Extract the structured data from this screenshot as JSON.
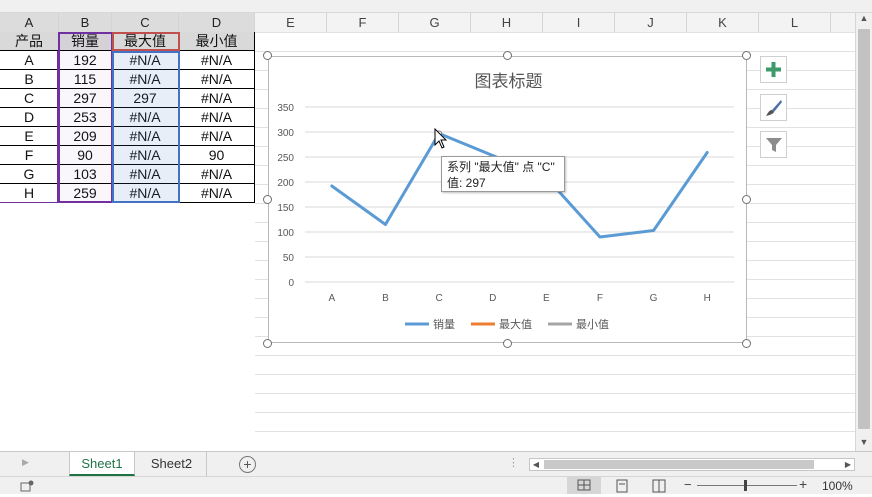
{
  "columns": [
    "A",
    "B",
    "C",
    "D",
    "E",
    "F",
    "G",
    "H",
    "I",
    "J",
    "K",
    "L"
  ],
  "table": {
    "headers": [
      "产品",
      "销量",
      "最大值",
      "最小值"
    ],
    "rows": [
      [
        "A",
        "192",
        "#N/A",
        "#N/A"
      ],
      [
        "B",
        "115",
        "#N/A",
        "#N/A"
      ],
      [
        "C",
        "297",
        "297",
        "#N/A"
      ],
      [
        "D",
        "253",
        "#N/A",
        "#N/A"
      ],
      [
        "E",
        "209",
        "#N/A",
        "#N/A"
      ],
      [
        "F",
        "90",
        "#N/A",
        "90"
      ],
      [
        "G",
        "103",
        "#N/A",
        "#N/A"
      ],
      [
        "H",
        "259",
        "#N/A",
        "#N/A"
      ]
    ]
  },
  "chart_data": {
    "type": "line",
    "title": "图表标题",
    "categories": [
      "A",
      "B",
      "C",
      "D",
      "E",
      "F",
      "G",
      "H"
    ],
    "series": [
      {
        "name": "销量",
        "values": [
          192,
          115,
          297,
          253,
          209,
          90,
          103,
          259
        ],
        "color": "#5b9bd5"
      },
      {
        "name": "最大值",
        "values": [
          null,
          null,
          297,
          null,
          null,
          null,
          null,
          null
        ],
        "color": "#ed7d31"
      },
      {
        "name": "最小值",
        "values": [
          null,
          null,
          null,
          null,
          null,
          90,
          null,
          null
        ],
        "color": "#a5a5a5"
      }
    ],
    "ylim": [
      0,
      350
    ],
    "yticks": [
      0,
      50,
      100,
      150,
      200,
      250,
      300,
      350
    ],
    "grid": true,
    "legend_position": "bottom"
  },
  "tooltip": {
    "line1": "系列 \"最大值\" 点 \"C\"",
    "line2": "值: 297"
  },
  "chart_buttons": {
    "add": "chart-elements",
    "style": "chart-styles",
    "filter": "chart-filters"
  },
  "sheets": [
    "Sheet1",
    "Sheet2"
  ],
  "active_sheet": "Sheet1",
  "zoom": "100%",
  "colors": {
    "accent": "#217346",
    "series_blue": "#5b9bd5",
    "selection_purple": "#7030a0",
    "selection_red": "#c0504d",
    "selection_blue": "#4472c4"
  }
}
